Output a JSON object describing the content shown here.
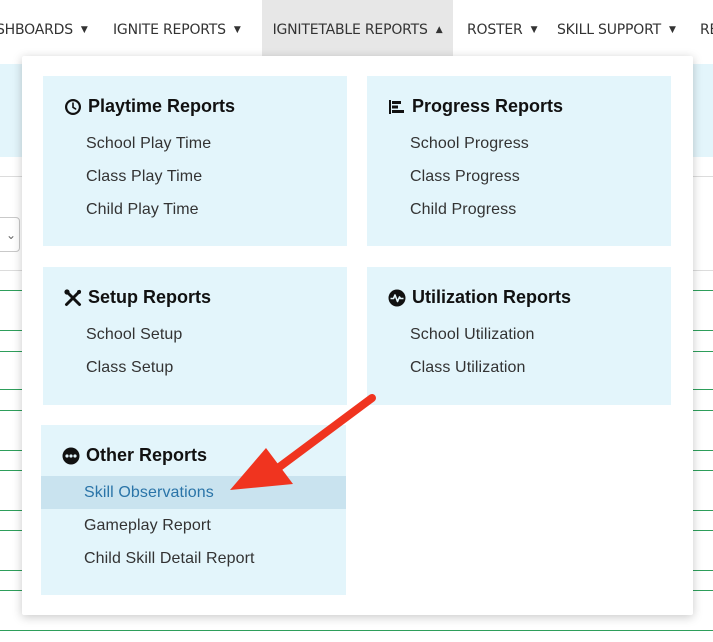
{
  "nav": {
    "items": [
      {
        "label": "SHBOARDS"
      },
      {
        "label": "IGNITE REPORTS"
      },
      {
        "label": "IGNITETABLE REPORTS"
      },
      {
        "label": "ROSTER"
      },
      {
        "label": "SKILL SUPPORT"
      },
      {
        "label": "RE"
      }
    ],
    "active_index": 2
  },
  "dropdown": {
    "playtime": {
      "title": "Playtime Reports",
      "links": [
        "School Play Time",
        "Class Play Time",
        "Child Play Time"
      ]
    },
    "progress": {
      "title": "Progress Reports",
      "links": [
        "School Progress",
        "Class Progress",
        "Child Progress"
      ]
    },
    "setup": {
      "title": "Setup Reports",
      "links": [
        "School Setup",
        "Class Setup"
      ]
    },
    "utilization": {
      "title": "Utilization Reports",
      "links": [
        "School Utilization",
        "Class Utilization"
      ]
    },
    "other": {
      "title": "Other Reports",
      "links": [
        "Skill Observations",
        "Gameplay Report",
        "Child Skill Detail Report"
      ],
      "highlighted_index": 0
    }
  },
  "colors": {
    "card_bg": "#e3f5fb",
    "highlight_bg": "#c9e3ef",
    "highlight_text": "#2a74a8",
    "annotation_arrow": "#f0341f",
    "row_line": "#2e9e5b"
  },
  "icons": {
    "playtime": "clock-icon",
    "progress": "bar-chart-icon",
    "setup": "tools-icon",
    "utilization": "heartbeat-icon",
    "other": "ellipsis-circle-icon"
  }
}
